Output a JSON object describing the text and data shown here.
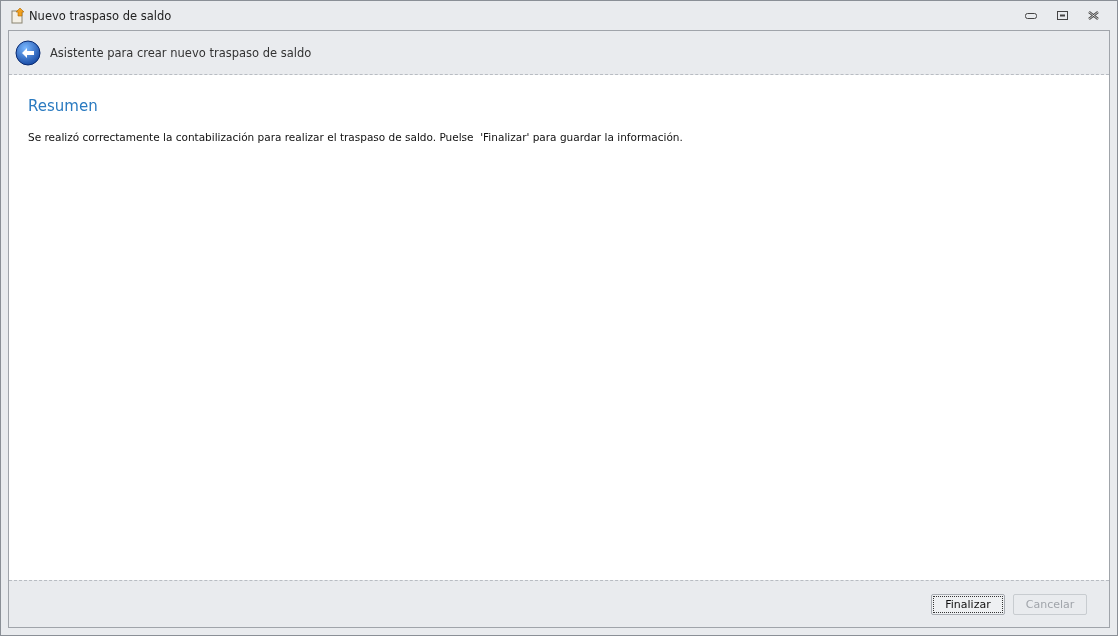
{
  "window": {
    "title": "Nuevo traspaso de saldo"
  },
  "wizard": {
    "header": "Asistente para crear nuevo traspaso de saldo"
  },
  "page": {
    "title": "Resumen",
    "message": "Se realizó correctamente la contabilización para realizar el traspaso de saldo. Puelse  'Finalizar' para guardar la información."
  },
  "buttons": [
    {
      "label": "Finalizar",
      "disabled": false
    },
    {
      "label": "Cancelar",
      "disabled": true
    }
  ]
}
